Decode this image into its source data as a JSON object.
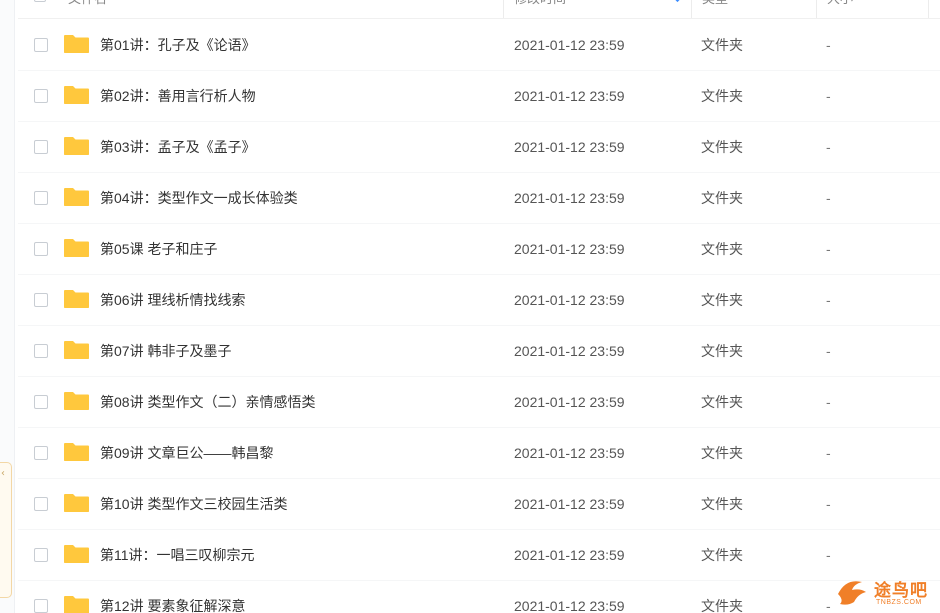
{
  "header": {
    "name_label": "文件名",
    "modified_label": "修改时间",
    "type_label": "类型",
    "size_label": "大小"
  },
  "colors": {
    "folder": "#ffc83d",
    "sort_accent": "#3b8cff",
    "watermark": "#f07f28"
  },
  "files": [
    {
      "name": "第01讲：孔子及《论语》",
      "modified": "2021-01-12 23:59",
      "type": "文件夹",
      "size": "-"
    },
    {
      "name": "第02讲：善用言行析人物",
      "modified": "2021-01-12 23:59",
      "type": "文件夹",
      "size": "-"
    },
    {
      "name": "第03讲：孟子及《孟子》",
      "modified": "2021-01-12 23:59",
      "type": "文件夹",
      "size": "-"
    },
    {
      "name": "第04讲：类型作文一成长体验类",
      "modified": "2021-01-12 23:59",
      "type": "文件夹",
      "size": "-"
    },
    {
      "name": "第05课 老子和庄子",
      "modified": "2021-01-12 23:59",
      "type": "文件夹",
      "size": "-"
    },
    {
      "name": "第06讲 理线析情找线索",
      "modified": "2021-01-12 23:59",
      "type": "文件夹",
      "size": "-"
    },
    {
      "name": "第07讲 韩非子及墨子",
      "modified": "2021-01-12 23:59",
      "type": "文件夹",
      "size": "-"
    },
    {
      "name": "第08讲 类型作文（二）亲情感悟类",
      "modified": "2021-01-12 23:59",
      "type": "文件夹",
      "size": "-"
    },
    {
      "name": "第09讲 文章巨公——韩昌黎",
      "modified": "2021-01-12 23:59",
      "type": "文件夹",
      "size": "-"
    },
    {
      "name": "第10讲 类型作文三校园生活类",
      "modified": "2021-01-12 23:59",
      "type": "文件夹",
      "size": "-"
    },
    {
      "name": "第11讲：一唱三叹柳宗元",
      "modified": "2021-01-12 23:59",
      "type": "文件夹",
      "size": "-"
    },
    {
      "name": "第12讲 要素象征解深意",
      "modified": "2021-01-12 23:59",
      "type": "文件夹",
      "size": "-"
    }
  ],
  "watermark": {
    "text": "途鸟吧",
    "sub": "TNBZS.COM"
  }
}
